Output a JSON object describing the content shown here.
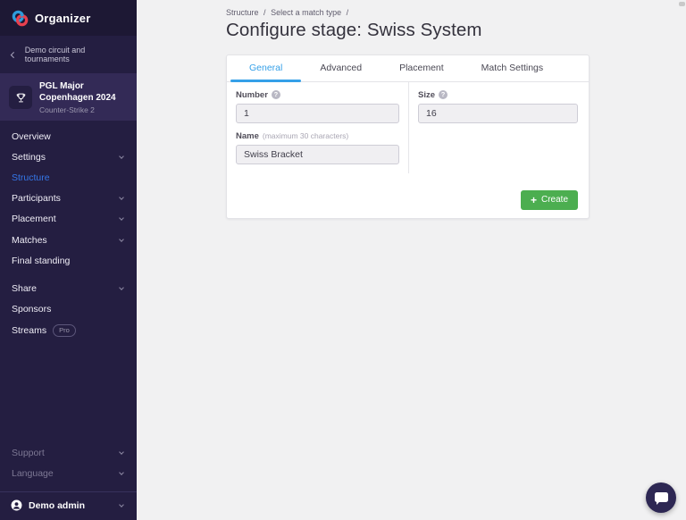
{
  "app": {
    "name": "Organizer"
  },
  "colors": {
    "sidebar_bg": "#241e41",
    "sidebar_header_bg": "#1d1834",
    "highlight_bg": "#332a56",
    "active_link": "#3577e8",
    "tab_active": "#35a0e8",
    "create_green": "#4cae50",
    "main_bg": "#f1f1f2",
    "chat_bubble": "#2d2753"
  },
  "icons": {
    "question": "?",
    "plus": "+"
  },
  "sidebar": {
    "back_label": "Demo circuit and tournaments",
    "tournament": {
      "title": "PGL Major Copenhagen 2024",
      "game": "Counter-Strike 2"
    },
    "items": [
      {
        "label": "Overview"
      },
      {
        "label": "Settings"
      },
      {
        "label": "Structure"
      },
      {
        "label": "Participants"
      },
      {
        "label": "Placement"
      },
      {
        "label": "Matches"
      },
      {
        "label": "Final standing"
      },
      {
        "label": "Share"
      },
      {
        "label": "Sponsors"
      },
      {
        "label": "Streams"
      }
    ],
    "streams_badge": "Pro",
    "footer_items": [
      {
        "label": "Support"
      },
      {
        "label": "Language"
      }
    ],
    "account": {
      "label": "Demo admin"
    }
  },
  "main": {
    "breadcrumb": {
      "structure": "Structure",
      "sep1": "/",
      "match_type": "Select a match type",
      "sep2": "/"
    },
    "title": "Configure stage: Swiss System",
    "tabs": [
      {
        "label": "General"
      },
      {
        "label": "Advanced"
      },
      {
        "label": "Placement"
      },
      {
        "label": "Match Settings"
      }
    ],
    "form": {
      "number": {
        "label": "Number",
        "value": "1"
      },
      "size": {
        "label": "Size",
        "value": "16"
      },
      "name": {
        "label": "Name",
        "hint": "(maximum 30 characters)",
        "value": "Swiss Bracket"
      }
    },
    "create_label": "Create"
  }
}
